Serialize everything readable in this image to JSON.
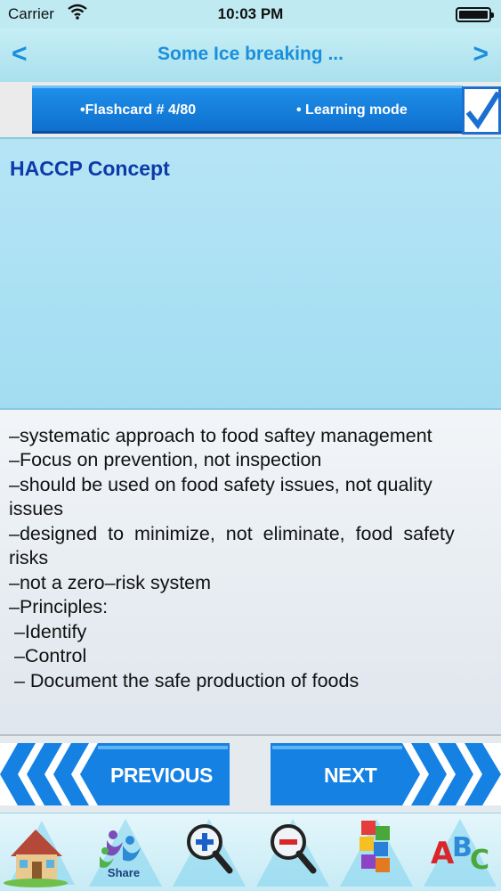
{
  "status": {
    "carrier": "Carrier",
    "time": "10:03 PM",
    "wifi_icon": "wifi-icon",
    "battery_icon": "battery-icon"
  },
  "nav": {
    "back": "<",
    "title": "Some Ice breaking ...",
    "forward": ">"
  },
  "info": {
    "flashcard": "•Flashcard #  4/80",
    "mode": "• Learning mode",
    "checkbox_icon": "checkbox-checked-icon"
  },
  "card": {
    "title": "HACCP Concept",
    "lines": [
      "–systematic approach to food saftey management",
      "–Focus on prevention, not inspection",
      "–should be used on food safety issues, not quality",
      "issues",
      "–designed  to  minimize,  not  eliminate,  food  safety",
      "risks",
      "–not a zero–risk system",
      "–Principles:",
      " –Identify",
      " –Control",
      " – Document the safe production of foods"
    ]
  },
  "buttons": {
    "previous": "PREVIOUS",
    "next": "NEXT"
  },
  "tabs": [
    {
      "icon": "home-icon",
      "label": ""
    },
    {
      "icon": "share-icon",
      "label": "Share"
    },
    {
      "icon": "zoom-in-icon",
      "label": ""
    },
    {
      "icon": "zoom-out-icon",
      "label": ""
    },
    {
      "icon": "puzzle-icon",
      "label": ""
    },
    {
      "icon": "abc-icon",
      "label": ""
    }
  ],
  "colors": {
    "accent": "#1a8fdc",
    "title": "#0d3aa8",
    "button_blue": "#1581e3"
  }
}
